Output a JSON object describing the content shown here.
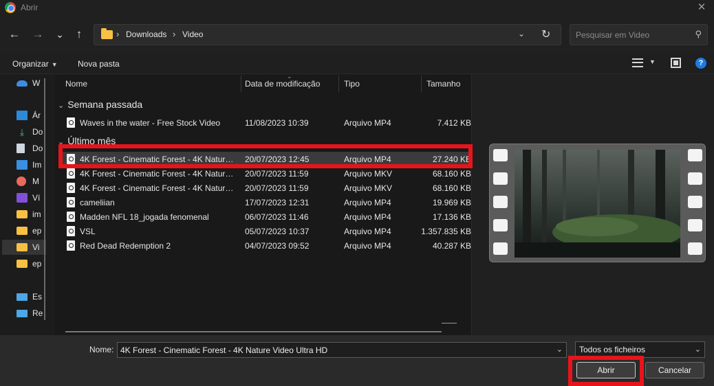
{
  "window": {
    "title": "Abrir",
    "close_glyph": "✕"
  },
  "nav": {
    "back_glyph": "←",
    "forward_glyph": "→",
    "recent_glyph": "⌄",
    "up_glyph": "↑",
    "breadcrumb": [
      "Downloads",
      "Video"
    ],
    "search_placeholder": "Pesquisar em Video"
  },
  "commands": {
    "organize": "Organizar",
    "new_folder": "Nova pasta"
  },
  "sidebar": {
    "items": [
      {
        "label": "W",
        "icon": "cloud-icon"
      },
      {
        "label": "Ár",
        "icon": "desktop-icon"
      },
      {
        "label": "Do",
        "icon": "download-icon"
      },
      {
        "label": "Do",
        "icon": "document-icon"
      },
      {
        "label": "Im",
        "icon": "image-icon"
      },
      {
        "label": "M",
        "icon": "music-icon"
      },
      {
        "label": "Ví",
        "icon": "video-icon"
      },
      {
        "label": "im",
        "icon": "folder-icon"
      },
      {
        "label": "ep",
        "icon": "folder-icon"
      },
      {
        "label": "Vi",
        "icon": "folder-icon"
      },
      {
        "label": "ep",
        "icon": "folder-icon"
      },
      {
        "label": "Es",
        "icon": "computer-icon"
      },
      {
        "label": "Re",
        "icon": "network-icon"
      }
    ]
  },
  "columns": {
    "name": "Nome",
    "date": "Data de modificação",
    "type": "Tipo",
    "size": "Tamanho"
  },
  "groups": [
    {
      "label": "Semana passada",
      "files": [
        {
          "name": "Waves in the water - Free Stock Video",
          "date": "11/08/2023 10:39",
          "type": "Arquivo MP4",
          "size": "7.412 KB"
        }
      ]
    },
    {
      "label": "Último mês",
      "files": [
        {
          "name": "4K Forest - Cinematic Forest - 4K Nature Video Ultra HD",
          "date": "20/07/2023 12:45",
          "type": "Arquivo MP4",
          "size": "27.240 KB"
        },
        {
          "name": "4K Forest - Cinematic Forest - 4K Nature Video Ultra HD",
          "date": "20/07/2023 11:59",
          "type": "Arquivo MKV",
          "size": "68.160 KB"
        },
        {
          "name": "4K Forest - Cinematic Forest - 4K Nature Video Ultra HD",
          "date": "20/07/2023 11:59",
          "type": "Arquivo MKV",
          "size": "68.160 KB"
        },
        {
          "name": "cameliian",
          "date": "17/07/2023 12:31",
          "type": "Arquivo MP4",
          "size": "19.969 KB"
        },
        {
          "name": "Madden NFL 18_jogada fenomenal",
          "date": "06/07/2023 11:46",
          "type": "Arquivo MP4",
          "size": "17.136 KB"
        },
        {
          "name": "VSL",
          "date": "05/07/2023 10:37",
          "type": "Arquivo MP4",
          "size": "1.357.835 KB"
        },
        {
          "name": "Red Dead Redemption 2",
          "date": "04/07/2023 09:52",
          "type": "Arquivo MP4",
          "size": "40.287 KB"
        }
      ]
    }
  ],
  "bottom": {
    "name_label": "Nome:",
    "name_value": "4K Forest - Cinematic Forest - 4K Nature Video Ultra HD",
    "file_type": "Todos os ficheiros",
    "open_button": "Abrir",
    "cancel_button": "Cancelar"
  },
  "colors": {
    "highlight": "#e8141c",
    "accent": "#1c7be0",
    "folder": "#f8c144"
  }
}
